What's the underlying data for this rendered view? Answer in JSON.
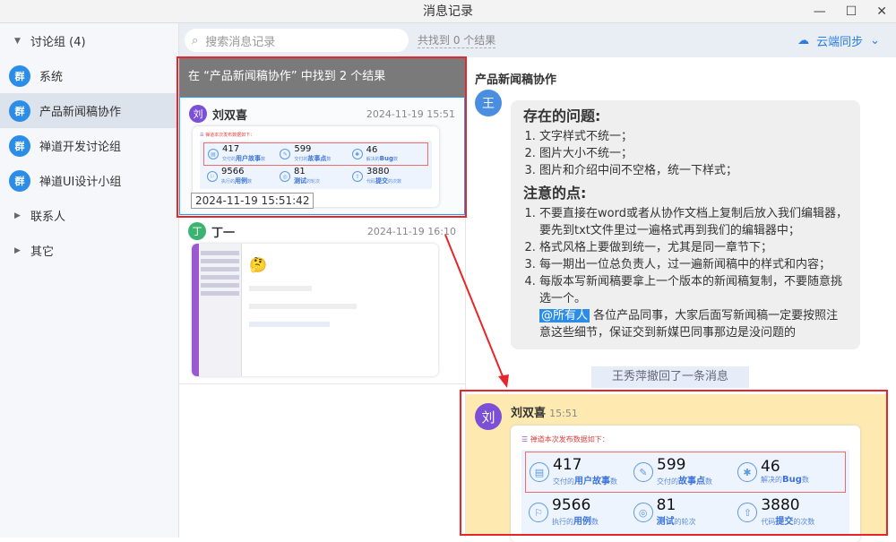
{
  "window": {
    "title": "消息记录",
    "min": "—",
    "max": "☐",
    "close": "✕"
  },
  "sidebar": {
    "groups": [
      {
        "label": "讨论组 (4)",
        "expanded": true
      },
      {
        "label": "联系人"
      },
      {
        "label": "其它"
      }
    ],
    "items": [
      {
        "icon": "群",
        "label": "系统"
      },
      {
        "icon": "群",
        "label": "产品新闻稿协作",
        "active": true
      },
      {
        "icon": "群",
        "label": "禅道开发讨论组"
      },
      {
        "icon": "群",
        "label": "禅道UI设计小组"
      }
    ]
  },
  "search": {
    "placeholder": "搜索消息记录",
    "found": "共找到 0 个结果",
    "sync": "云端同步"
  },
  "results": {
    "header": "在 “产品新闻稿协作” 中找到 2 个结果",
    "tooltip": "2024-11-19 15:51:42",
    "items": [
      {
        "avatar": "刘",
        "name": "刘双喜",
        "time": "2024-11-19 15:51",
        "color": "#7b4fd6"
      },
      {
        "avatar": "丁",
        "name": "丁一",
        "time": "2024-11-19 16:10",
        "color": "#3cb371"
      }
    ]
  },
  "card": {
    "title": "禅道本次发布数据如下：",
    "stats": [
      {
        "icon": "▤",
        "num": "417",
        "pre": "交付的",
        "key": "用户故事",
        "post": "数"
      },
      {
        "icon": "✎",
        "num": "599",
        "pre": "交付的",
        "key": "故事点",
        "post": "数"
      },
      {
        "icon": "✱",
        "num": "46",
        "pre": "解决的",
        "key": "Bug",
        "post": "数"
      },
      {
        "icon": "⚐",
        "num": "9566",
        "pre": "执行的",
        "key": "用例",
        "post": "数"
      },
      {
        "icon": "◎",
        "num": "81",
        "pre": "",
        "key": "测试",
        "post": "的轮次"
      },
      {
        "icon": "⇧",
        "num": "3880",
        "pre": "代码",
        "key": "提交",
        "post": "的次数"
      }
    ]
  },
  "chat": {
    "title": "产品新闻稿协作",
    "avatar": "王",
    "h1": "存在的问题:",
    "list1": [
      "文字样式不统一；",
      "图片大小不统一；",
      "图片和介绍中间不空格，统一下样式；"
    ],
    "h2": "注意的点:",
    "list2": [
      "不要直接在word或者从协作文档上复制后放入我们编辑器，要先到txt文件里过一遍格式再到我们的编辑器中；",
      "格式风格上要做到统一，尤其是同一章节下；",
      "每一期出一位总负责人，过一遍新闻稿中的样式和内容；",
      "每版本写新闻稿要拿上一个版本的新闻稿复制，不要随意挑选一个。"
    ],
    "mention": "@所有人",
    "mention_text": " 各位产品同事，大家后面写新闻稿一定要按照注意这些细节，保证交到新媒巴同事那边是没问题的",
    "recall": "王秀萍撤回了一条消息",
    "highlight": {
      "avatar": "刘",
      "name": "刘双喜",
      "time": "15:51"
    }
  }
}
